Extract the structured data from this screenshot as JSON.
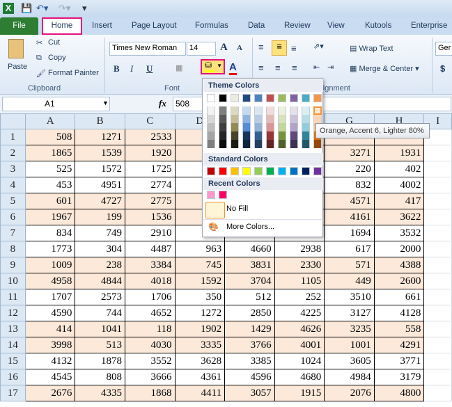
{
  "quick_access": {
    "app_icon": "excel-icon",
    "save_icon": "save-icon",
    "undo_icon": "undo-icon",
    "redo_icon": "redo-icon",
    "customize_icon": "customize-icon"
  },
  "tabs": [
    "File",
    "Home",
    "Insert",
    "Page Layout",
    "Formulas",
    "Data",
    "Review",
    "View",
    "Kutools",
    "Enterprise"
  ],
  "clipboard": {
    "paste": "Paste",
    "cut": "Cut",
    "copy": "Copy",
    "format_painter": "Format Painter",
    "group": "Clipboard"
  },
  "font": {
    "name": "Times New Roman",
    "size": "14",
    "bold": "B",
    "italic": "I",
    "underline": "U",
    "grow": "A",
    "shrink": "A",
    "font_color_letter": "A",
    "group": "Font"
  },
  "alignment": {
    "wrap": "Wrap Text",
    "merge": "Merge & Center",
    "group": "Alignment",
    "group_visible": "ignment"
  },
  "number": {
    "format": "Ger",
    "currency": "$"
  },
  "formula_bar": {
    "name_box": "A1",
    "fx": "fx",
    "value": "508"
  },
  "columns": [
    "A",
    "B",
    "C",
    "D",
    "E",
    "F",
    "G",
    "H",
    "I"
  ],
  "rows": [
    {
      "n": "1",
      "shaded": true,
      "cells": [
        "508",
        "1271",
        "2533",
        "",
        "",
        "",
        "",
        "",
        ""
      ]
    },
    {
      "n": "2",
      "shaded": true,
      "cells": [
        "1865",
        "1539",
        "1920",
        "",
        "",
        "",
        "3271",
        "1931",
        ""
      ]
    },
    {
      "n": "3",
      "shaded": false,
      "cells": [
        "525",
        "1572",
        "1725",
        "",
        "",
        "",
        "220",
        "402",
        ""
      ]
    },
    {
      "n": "4",
      "shaded": false,
      "cells": [
        "453",
        "4951",
        "2774",
        "",
        "",
        "",
        "832",
        "4002",
        ""
      ]
    },
    {
      "n": "5",
      "shaded": true,
      "cells": [
        "601",
        "4727",
        "2775",
        "",
        "",
        "",
        "4571",
        "417",
        ""
      ]
    },
    {
      "n": "6",
      "shaded": true,
      "cells": [
        "1967",
        "199",
        "1536",
        "",
        "",
        "",
        "4161",
        "3622",
        ""
      ]
    },
    {
      "n": "7",
      "shaded": false,
      "cells": [
        "834",
        "749",
        "2910",
        "",
        "",
        "",
        "1694",
        "3532",
        ""
      ]
    },
    {
      "n": "8",
      "shaded": false,
      "cells": [
        "1773",
        "304",
        "4487",
        "963",
        "4660",
        "2938",
        "617",
        "2000",
        ""
      ]
    },
    {
      "n": "9",
      "shaded": true,
      "cells": [
        "1009",
        "238",
        "3384",
        "745",
        "3831",
        "2330",
        "571",
        "4388",
        ""
      ]
    },
    {
      "n": "10",
      "shaded": true,
      "cells": [
        "4958",
        "4844",
        "4018",
        "1592",
        "3704",
        "1105",
        "449",
        "2600",
        ""
      ]
    },
    {
      "n": "11",
      "shaded": false,
      "cells": [
        "1707",
        "2573",
        "1706",
        "350",
        "512",
        "252",
        "3510",
        "661",
        ""
      ]
    },
    {
      "n": "12",
      "shaded": false,
      "cells": [
        "4590",
        "744",
        "4652",
        "1272",
        "2850",
        "4225",
        "3127",
        "4128",
        ""
      ]
    },
    {
      "n": "13",
      "shaded": true,
      "cells": [
        "414",
        "1041",
        "118",
        "1902",
        "1429",
        "4626",
        "3235",
        "558",
        ""
      ]
    },
    {
      "n": "14",
      "shaded": true,
      "cells": [
        "3998",
        "513",
        "4030",
        "3335",
        "3766",
        "4001",
        "1001",
        "4291",
        ""
      ]
    },
    {
      "n": "15",
      "shaded": false,
      "cells": [
        "4132",
        "1878",
        "3552",
        "3628",
        "3385",
        "1024",
        "3605",
        "3771",
        ""
      ]
    },
    {
      "n": "16",
      "shaded": false,
      "cells": [
        "4545",
        "808",
        "3666",
        "4361",
        "4596",
        "4680",
        "4984",
        "3179",
        ""
      ]
    },
    {
      "n": "17",
      "shaded": true,
      "cells": [
        "2676",
        "4335",
        "1868",
        "4411",
        "3057",
        "1915",
        "2076",
        "4800",
        ""
      ]
    }
  ],
  "fill_menu": {
    "theme_title": "Theme Colors",
    "theme": [
      "#ffffff",
      "#000000",
      "#eeece1",
      "#1f497d",
      "#4f81bd",
      "#c0504d",
      "#9bbb59",
      "#8064a2",
      "#4bacc6",
      "#f79646"
    ],
    "shades": [
      [
        "#f2f2f2",
        "#d8d8d8",
        "#bfbfbf",
        "#a5a5a5",
        "#7f7f7f"
      ],
      [
        "#7f7f7f",
        "#595959",
        "#3f3f3f",
        "#262626",
        "#0c0c0c"
      ],
      [
        "#ddd9c3",
        "#c4bd97",
        "#938953",
        "#494429",
        "#1d1b10"
      ],
      [
        "#c6d9f0",
        "#8db3e2",
        "#548dd4",
        "#17365d",
        "#0f243e"
      ],
      [
        "#dbe5f1",
        "#b8cce4",
        "#95b3d7",
        "#366092",
        "#244061"
      ],
      [
        "#f2dcdb",
        "#e5b9b7",
        "#d99694",
        "#953734",
        "#632423"
      ],
      [
        "#ebf1dd",
        "#d7e3bc",
        "#c3d69b",
        "#76923c",
        "#4f6128"
      ],
      [
        "#e5e0ec",
        "#ccc1d9",
        "#b2a2c7",
        "#5f497a",
        "#3f3151"
      ],
      [
        "#dbeef3",
        "#b7dde8",
        "#92cddc",
        "#31859b",
        "#205867"
      ],
      [
        "#fdeada",
        "#fbd5b5",
        "#fac08f",
        "#e36c09",
        "#974806"
      ]
    ],
    "standard_title": "Standard Colors",
    "standard": [
      "#c00000",
      "#ff0000",
      "#ffc000",
      "#ffff00",
      "#92d050",
      "#00b050",
      "#00b0f0",
      "#0070c0",
      "#002060",
      "#7030a0"
    ],
    "recent_title": "Recent Colors",
    "recent": [
      "#ff99cc",
      "#ff0066"
    ],
    "no_fill": "No Fill",
    "more_colors": "More Colors...",
    "tooltip": "Orange, Accent 6, Lighter 80%"
  }
}
